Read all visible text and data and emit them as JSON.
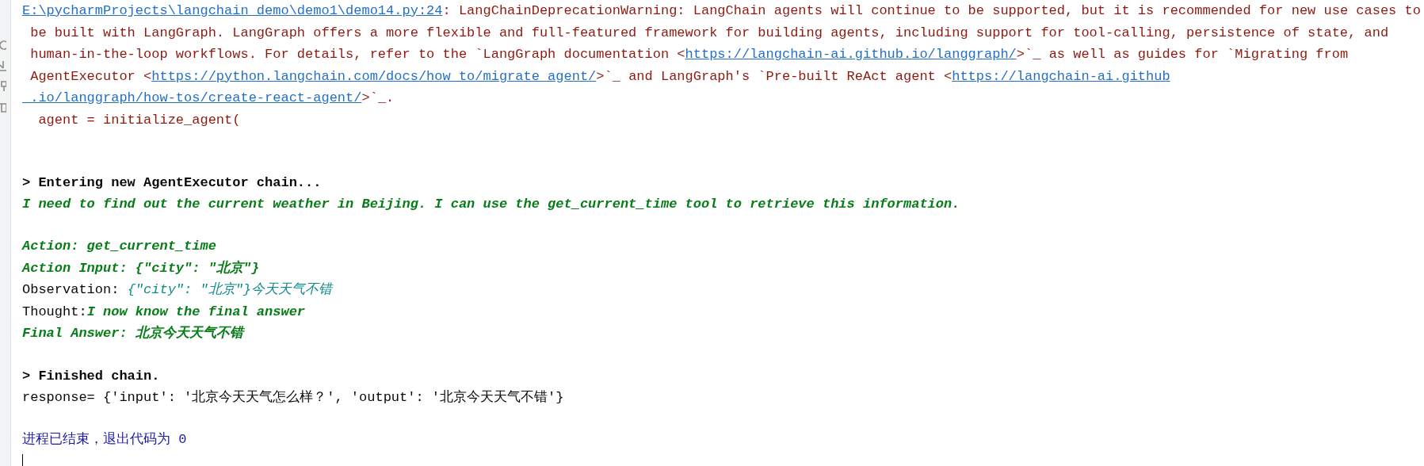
{
  "console": {
    "lines": [
      {
        "kind": "output",
        "segments": [
          {
            "kind": "path-link",
            "text": "E:\\pycharmProjects\\langchain_demo\\demo1\\demo14.py:24"
          },
          {
            "kind": "warning",
            "text": ": LangChainDeprecationWarning: LangChain agents will continue to be supported, but it is recommended for new use cases to"
          }
        ]
      },
      {
        "kind": "output",
        "segments": [
          {
            "kind": "warning",
            "text": " be built with LangGraph. LangGraph offers a more flexible and full-featured framework for building agents, including support for tool-calling, persistence of state, and"
          }
        ]
      },
      {
        "kind": "output",
        "segments": [
          {
            "kind": "warning",
            "text": " human-in-the-loop workflows. For details, refer to the `LangGraph documentation <"
          },
          {
            "kind": "url-link",
            "text": "https://langchain-ai.github.io/langgraph/"
          },
          {
            "kind": "warning",
            "text": ">`_ as well as guides for `Migrating from"
          }
        ]
      },
      {
        "kind": "output",
        "segments": [
          {
            "kind": "warning",
            "text": " AgentExecutor <"
          },
          {
            "kind": "url-link",
            "text": "https://python.langchain.com/docs/how_to/migrate_agent/"
          },
          {
            "kind": "warning",
            "text": ">`_ and LangGraph's `Pre-built ReAct agent <"
          },
          {
            "kind": "url-link",
            "text": "https://langchain-ai.github"
          }
        ]
      },
      {
        "kind": "output",
        "segments": [
          {
            "kind": "url-link",
            "text": " .io/langgraph/how-tos/create-react-agent/"
          },
          {
            "kind": "warning",
            "text": ">`_."
          }
        ]
      },
      {
        "kind": "output",
        "segments": [
          {
            "kind": "warning",
            "text": "  agent = initialize_agent("
          }
        ]
      },
      {
        "kind": "blank"
      },
      {
        "kind": "blank"
      },
      {
        "kind": "output",
        "segments": [
          {
            "kind": "bold",
            "text": "> Entering new AgentExecutor chain..."
          }
        ]
      },
      {
        "kind": "output",
        "segments": [
          {
            "kind": "agent",
            "text": "I need to find out the current weather in Beijing. I can use the get_current_time tool to retrieve this information."
          }
        ]
      },
      {
        "kind": "blank"
      },
      {
        "kind": "output",
        "segments": [
          {
            "kind": "agent",
            "text": "Action: get_current_time"
          }
        ]
      },
      {
        "kind": "output",
        "segments": [
          {
            "kind": "agent",
            "text": "Action Input: {\"city\": \"北京\"}"
          }
        ]
      },
      {
        "kind": "output",
        "segments": [
          {
            "kind": "plain",
            "text": "Observation: "
          },
          {
            "kind": "observation",
            "text": "{\"city\": \"北京\"}今天天气不错"
          }
        ]
      },
      {
        "kind": "output",
        "segments": [
          {
            "kind": "plain",
            "text": "Thought:"
          },
          {
            "kind": "agent",
            "text": "I now know the final answer"
          }
        ]
      },
      {
        "kind": "output",
        "segments": [
          {
            "kind": "agent",
            "text": "Final Answer: 北京今天天气不错"
          }
        ]
      },
      {
        "kind": "blank"
      },
      {
        "kind": "output",
        "segments": [
          {
            "kind": "bold",
            "text": "> Finished chain."
          }
        ]
      },
      {
        "kind": "output",
        "segments": [
          {
            "kind": "plain",
            "text": "response= {'input': '北京今天天气怎么样？', 'output': '北京今天天气不错'}"
          }
        ]
      },
      {
        "kind": "blank"
      },
      {
        "kind": "output",
        "segments": [
          {
            "kind": "exit",
            "text": "进程已结束，退出代码为 0"
          }
        ]
      }
    ]
  }
}
